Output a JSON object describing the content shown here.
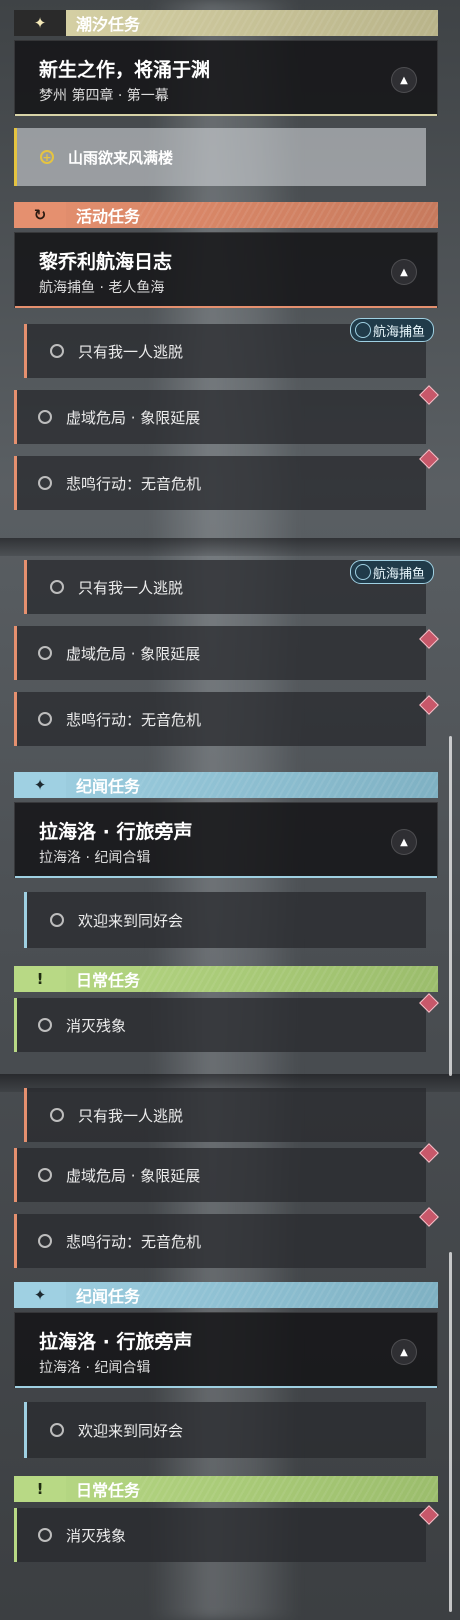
{
  "colors": {
    "tide": "#d8d3a7",
    "event": "#e5906f",
    "lore": "#9fd0e2",
    "daily": "#b8d985"
  },
  "segments": [
    {
      "tide": {
        "category": "潮汐任务",
        "icon": "sparkle-icon",
        "main": "新生之作，将涌于渊",
        "sub": "梦州 第四章 · 第一幕",
        "current": "山雨欲来风满楼"
      },
      "event": {
        "category": "活动任务",
        "icon": "cycle-icon",
        "main": "黎乔利航海日志",
        "sub": "航海捕鱼 · 老人鱼海",
        "tag": "航海捕鱼",
        "items": [
          "只有我一人逃脱",
          "虚域危局 · 象限延展",
          "悲鸣行动：无音危机"
        ]
      }
    },
    {
      "tag": "航海捕鱼",
      "items": [
        "只有我一人逃脱",
        "虚域危局 · 象限延展",
        "悲鸣行动：无音危机"
      ],
      "lore": {
        "category": "纪闻任务",
        "icon": "sparkle-icon",
        "main": "拉海洛 · 行旅旁声",
        "sub": "拉海洛 · 纪闻合辑",
        "item": "欢迎来到同好会"
      },
      "daily": {
        "category": "日常任务",
        "icon": "exclaim-icon",
        "item": "消灭残象"
      }
    },
    {
      "items": [
        "只有我一人逃脱",
        "虚域危局 · 象限延展",
        "悲鸣行动：无音危机"
      ],
      "lore": {
        "category": "纪闻任务",
        "icon": "sparkle-icon",
        "main": "拉海洛 · 行旅旁声",
        "sub": "拉海洛 · 纪闻合辑",
        "item": "欢迎来到同好会"
      },
      "daily": {
        "category": "日常任务",
        "icon": "exclaim-icon",
        "item": "消灭残象"
      }
    }
  ]
}
